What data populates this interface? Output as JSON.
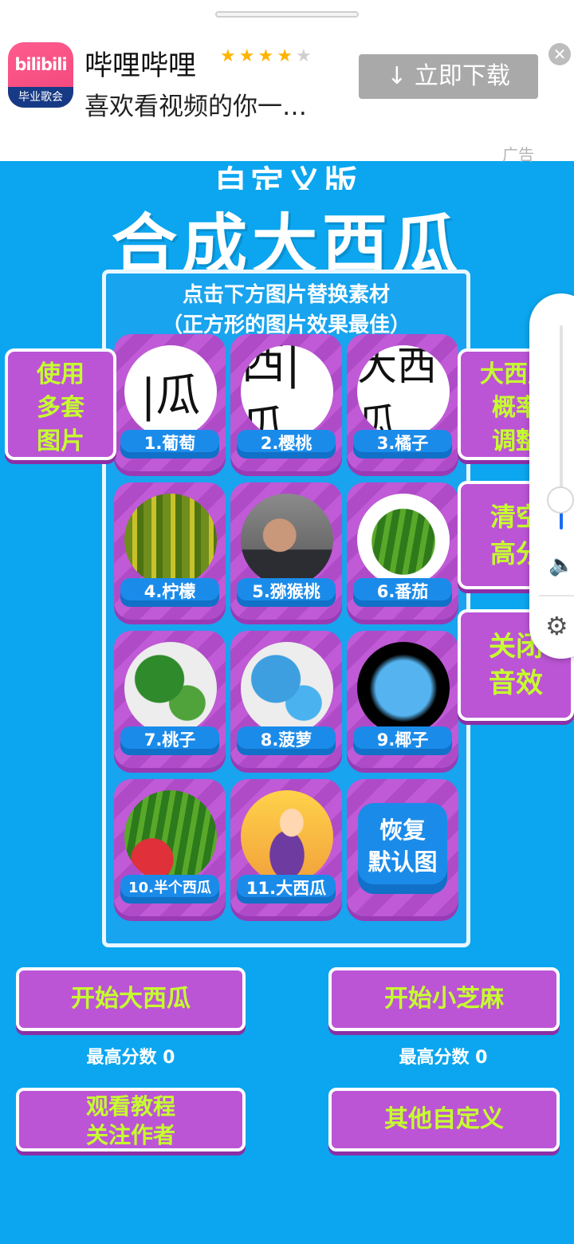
{
  "ad": {
    "app_icon_text": "bilibili",
    "app_icon_sub": "毕业歌会",
    "app_name": "哔哩哔哩",
    "rating_stars": 4,
    "description": "喜欢看视频的你一…",
    "download_label": "↓ 立即下载",
    "close_symbol": "✕",
    "ad_tag": "广告"
  },
  "title_small": "自定义版",
  "title_big": "合成大西瓜",
  "hint_line1": "点击下方图片替换素材",
  "hint_line2": "（正方形的图片效果最佳）",
  "tiles": [
    {
      "label": "1.葡萄",
      "pic_text": "|瓜"
    },
    {
      "label": "2.樱桃",
      "pic_text": "西|瓜"
    },
    {
      "label": "3.橘子",
      "pic_text": "大西瓜"
    },
    {
      "label": "4.柠檬"
    },
    {
      "label": "5.猕猴桃"
    },
    {
      "label": "6.番茄"
    },
    {
      "label": "7.桃子"
    },
    {
      "label": "8.菠萝"
    },
    {
      "label": "9.椰子"
    },
    {
      "label": "10.半个西瓜"
    },
    {
      "label": "11.大西瓜"
    }
  ],
  "reset_button": {
    "line1": "恢复",
    "line2": "默认图"
  },
  "side_left": {
    "line1": "使用",
    "line2": "多套",
    "line3": "图片"
  },
  "side_right_1": {
    "line1": "大西瓜",
    "line2": "概率",
    "line3": "调整"
  },
  "side_right_2": {
    "line1": "清空",
    "line2": "高分"
  },
  "side_right_3": {
    "line1": "关闭",
    "line2": "音效"
  },
  "buttons": {
    "start_big": "开始大西瓜",
    "start_small": "开始小芝麻",
    "tutorial_line1": "观看教程",
    "tutorial_line2": "关注作者",
    "other_custom": "其他自定义"
  },
  "scores": {
    "left": "最高分数 0",
    "right": "最高分数 0"
  },
  "volume": {
    "level_percent": 15
  },
  "colors": {
    "background": "#0ba6ef",
    "button_purple": "#bb55d6",
    "button_text": "#c6ff2e",
    "label_blue": "#1b8bea"
  }
}
